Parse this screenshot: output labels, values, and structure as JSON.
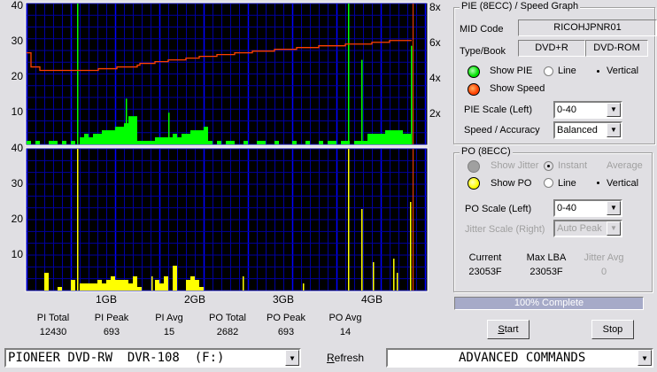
{
  "charts": {
    "pie": {
      "left_ticks": [
        "40",
        "30",
        "20",
        "10"
      ],
      "right_ticks": [
        "8x",
        "6x",
        "4x",
        "2x"
      ]
    },
    "po": {
      "left_ticks": [
        "40",
        "30",
        "20",
        "10"
      ]
    },
    "x_ticks": [
      "1GB",
      "2GB",
      "3GB",
      "4GB"
    ],
    "colors": {
      "pie": "#00ff00",
      "po": "#ffff00",
      "speed": "#ff4000",
      "grid": "#0000a0",
      "major": "#0000ff",
      "bg": "#000000"
    }
  },
  "chart_data": {
    "type": "bar",
    "ylim": [
      0,
      40
    ],
    "speed_ylim": [
      0,
      8
    ],
    "pie_samples": [
      1,
      0,
      1,
      0,
      0,
      1,
      1,
      0,
      1,
      0,
      1,
      0,
      2,
      3,
      2,
      3,
      3,
      4,
      4,
      4,
      5,
      5,
      6,
      8,
      8,
      1,
      1,
      1,
      1,
      2,
      2,
      2,
      2,
      3,
      2,
      3,
      3,
      4,
      4,
      4,
      5,
      1,
      0,
      1,
      0,
      1,
      1,
      0,
      0,
      1,
      0,
      0,
      1,
      1,
      0,
      0,
      1,
      0,
      0,
      0,
      1,
      0,
      0,
      1,
      0,
      0,
      1,
      0,
      1,
      1,
      0,
      1,
      1,
      0,
      1,
      1,
      1,
      3,
      3,
      3,
      3,
      4,
      4,
      4,
      4,
      3,
      3,
      0,
      0,
      0
    ],
    "pie_spikes": [
      [
        11.4,
        40
      ],
      [
        22.4,
        13
      ],
      [
        32,
        9
      ],
      [
        72.6,
        40
      ],
      [
        75.6,
        24
      ],
      [
        86.8,
        28
      ]
    ],
    "po_samples": [
      0,
      0,
      0,
      0,
      5,
      0,
      0,
      1,
      0,
      0,
      3,
      0,
      2,
      2,
      2,
      2,
      3,
      2,
      3,
      4,
      3,
      3,
      3,
      2,
      4,
      1,
      0,
      0,
      0,
      3,
      2,
      4,
      0,
      7,
      0,
      0,
      3,
      4,
      3,
      1,
      0,
      0,
      0,
      0,
      0,
      0,
      0,
      0,
      0,
      0,
      0,
      0,
      0,
      0,
      0,
      0,
      0,
      0,
      0,
      0,
      0,
      0,
      0,
      0,
      0,
      0,
      0,
      0,
      0,
      0,
      0,
      0,
      0,
      0,
      0,
      0,
      0,
      0,
      0,
      0,
      0,
      0,
      0,
      0,
      0,
      0,
      0,
      0,
      0,
      0
    ],
    "po_spikes": [
      [
        11.4,
        40
      ],
      [
        28.2,
        4
      ],
      [
        48.8,
        4
      ],
      [
        62.4,
        2
      ],
      [
        72.6,
        40
      ],
      [
        75.6,
        23
      ],
      [
        78.2,
        8
      ],
      [
        82.8,
        9
      ],
      [
        83.6,
        5
      ],
      [
        86.6,
        25
      ]
    ],
    "speed_points": [
      [
        0,
        5.2
      ],
      [
        1,
        4.4
      ],
      [
        3,
        4.2
      ],
      [
        10,
        4.2
      ],
      [
        16,
        4.2
      ],
      [
        16.2,
        4.3
      ],
      [
        20,
        4.3
      ],
      [
        20.4,
        4.4
      ],
      [
        25,
        4.5
      ],
      [
        25.6,
        4.6
      ],
      [
        29,
        4.7
      ],
      [
        32,
        4.8
      ],
      [
        36,
        4.9
      ],
      [
        39,
        5.0
      ],
      [
        43,
        5.1
      ],
      [
        47,
        5.2
      ],
      [
        51,
        5.3
      ],
      [
        56,
        5.4
      ],
      [
        61,
        5.5
      ],
      [
        66,
        5.6
      ],
      [
        72,
        5.7
      ],
      [
        78,
        5.8
      ],
      [
        82,
        5.9
      ],
      [
        87,
        5.9
      ]
    ]
  },
  "stats": [
    {
      "label": "PI Total",
      "value": "12430"
    },
    {
      "label": "PI Peak",
      "value": "693"
    },
    {
      "label": "PI Avg",
      "value": "15"
    },
    {
      "label": "PO Total",
      "value": "2682"
    },
    {
      "label": "PO Peak",
      "value": "693"
    },
    {
      "label": "PO Avg",
      "value": "14"
    }
  ],
  "pie_panel": {
    "title": "PIE (8ECC) / Speed Graph",
    "mid_label": "MID Code",
    "mid_value": "RICOHJPNR01",
    "type_label": "Type/Book",
    "type_value": "DVD+R",
    "book_value": "DVD-ROM",
    "show_pie": "Show PIE",
    "line": "Line",
    "vertical": "Vertical",
    "show_speed": "Show Speed",
    "scale_label": "PIE Scale (Left)",
    "scale_value": "0-40",
    "accuracy_label": "Speed / Accuracy",
    "accuracy_value": "Balanced"
  },
  "po_panel": {
    "title": "PO (8ECC)",
    "show_jitter": "Show Jitter",
    "instant": "Instant",
    "average": "Average",
    "show_po": "Show PO",
    "line": "Line",
    "vertical": "Vertical",
    "scale_label": "PO Scale (Left)",
    "scale_value": "0-40",
    "jitter_label": "Jitter Scale (Right)",
    "jitter_value": "Auto Peak",
    "current_label": "Current",
    "current_value": "23053F",
    "maxlba_label": "Max LBA",
    "maxlba_value": "23053F",
    "jitteravg_label": "Jitter Avg",
    "jitteravg_value": "0"
  },
  "progress": {
    "text": "100% Complete",
    "percent": 100
  },
  "buttons": {
    "start": "Start",
    "stop": "Stop",
    "refresh": "Refresh"
  },
  "drive": "PIONEER DVD-RW  DVR-108  (F:)",
  "advanced": "ADVANCED COMMANDS"
}
